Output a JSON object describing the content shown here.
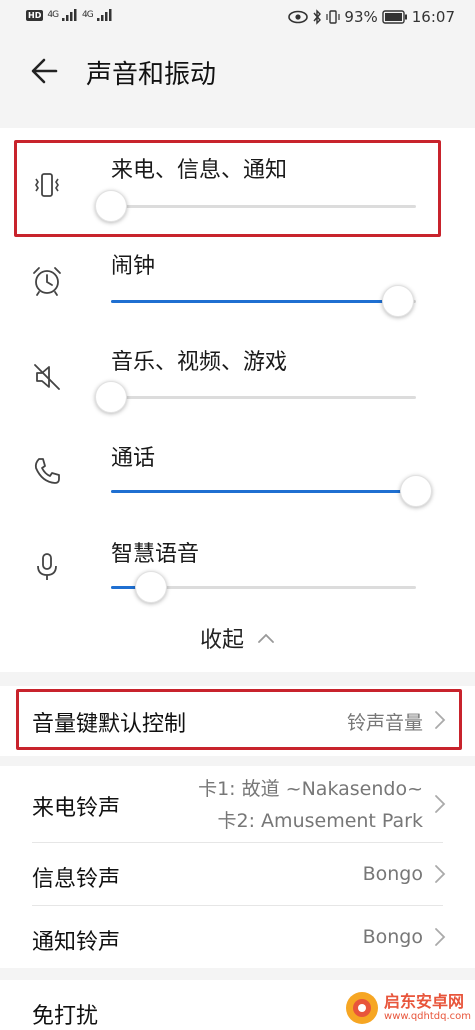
{
  "status_bar": {
    "hd": "HD",
    "sim1": "4G",
    "sim2": "4G",
    "battery": "93%",
    "time": "16:07"
  },
  "header": {
    "title": "声音和振动",
    "back_icon": "arrow-left-icon"
  },
  "volume_sliders": [
    {
      "label": "来电、信息、通知",
      "icon": "vibrate-icon",
      "level": 0.0
    },
    {
      "label": "闹钟",
      "icon": "alarm-clock-icon",
      "level": 0.94
    },
    {
      "label": "音乐、视频、游戏",
      "icon": "muted-speaker-icon",
      "level": 0.0
    },
    {
      "label": "通话",
      "icon": "phone-icon",
      "level": 1.0
    },
    {
      "label": "智慧语音",
      "icon": "microphone-icon",
      "level": 0.13
    }
  ],
  "collapse": {
    "label": "收起"
  },
  "settings_rows": {
    "volume_key": {
      "label": "音量键默认控制",
      "value": "铃声音量"
    },
    "ringtone": {
      "label": "来电铃声",
      "value_line1": "卡1: 故道 ~Nakasendo~",
      "value_line2": "卡2: Amusement Park"
    },
    "message_tone": {
      "label": "信息铃声",
      "value": "Bongo"
    },
    "notification_tone": {
      "label": "通知铃声",
      "value": "Bongo"
    },
    "dnd": {
      "label": "免打扰"
    }
  },
  "watermark": {
    "main": "启东安卓网",
    "sub": "www.qdhtdq.com"
  },
  "colors": {
    "accent": "#1f6fd1",
    "highlight": "#c8232c",
    "background": "#ffffff",
    "band": "#f4f4f4"
  }
}
